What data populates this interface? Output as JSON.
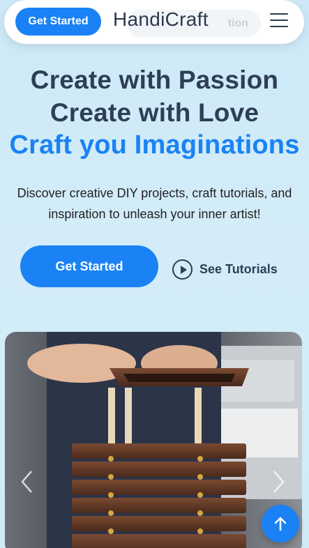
{
  "header": {
    "cta_label": "Get Started",
    "ghost_label": "tion",
    "brand": "HandiCraft"
  },
  "hero": {
    "line1": "Create with Passion",
    "line2": "Create with Love",
    "line3": "Craft you Imaginations",
    "subtitle": "Discover creative DIY projects, craft tutorials, and inspiration to unleash your inner artist!"
  },
  "actions": {
    "primary_label": "Get Started",
    "secondary_label": "See Tutorials"
  },
  "carousel": {
    "icons": {
      "prev": "chevron-left-icon",
      "next": "chevron-right-icon"
    }
  },
  "colors": {
    "accent": "#1a82f5",
    "heading": "#2e3e55",
    "background": "#cde9f7"
  }
}
